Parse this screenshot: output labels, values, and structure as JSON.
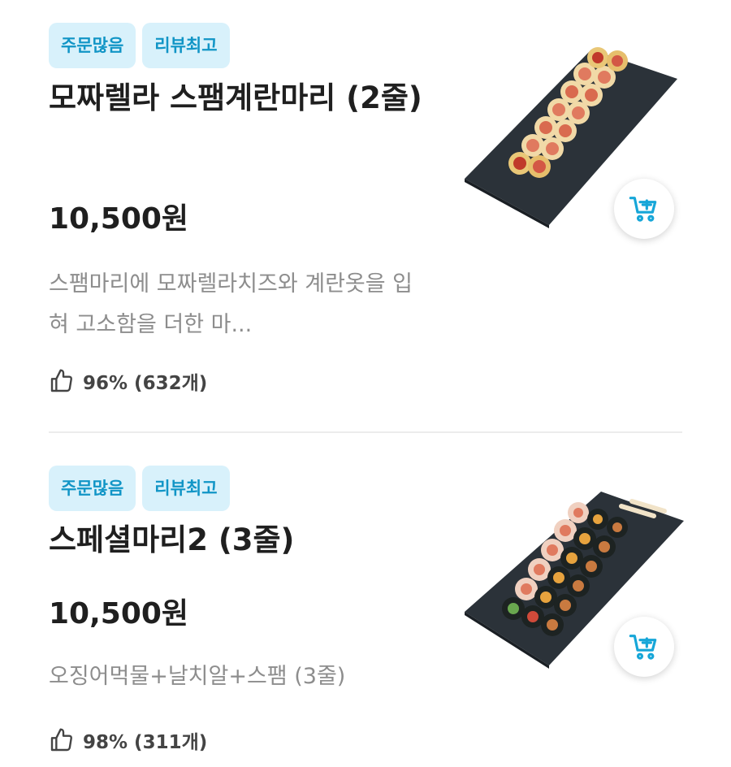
{
  "items": [
    {
      "badges": [
        "주문많음",
        "리뷰최고"
      ],
      "title": "모짜렐라 스팸계란마리 (2줄)",
      "price": "10,500원",
      "description": "스팸마리에 모짜렐라치즈와 계란옷을 입혀 고소함을 더한 마...",
      "rating_text": "96% (632개)",
      "image_icon": "kimbap-platter-image"
    },
    {
      "badges": [
        "주문많음",
        "리뷰최고"
      ],
      "title": "스페셜마리2 (3줄)",
      "price": "10,500원",
      "description": "오징어먹물+날치알+스팸 (3줄)",
      "rating_text": "98% (311개)",
      "image_icon": "kimbap-platter-image"
    }
  ],
  "colors": {
    "badge_bg": "#d8f1fb",
    "badge_text": "#1195c6",
    "accent": "#16a6d8",
    "muted_text": "#8d8d8d"
  }
}
